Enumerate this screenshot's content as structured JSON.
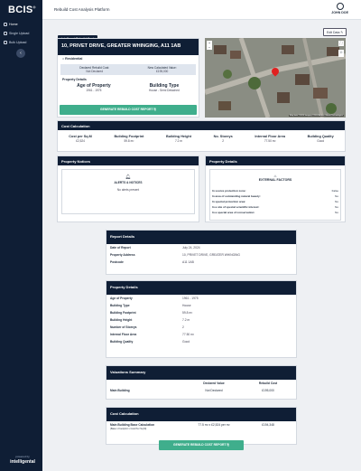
{
  "sidebar": {
    "logo": "BCIS",
    "items": [
      {
        "label": "Home",
        "active": true
      },
      {
        "label": "Single Upload",
        "active": false
      },
      {
        "label": "Bulk Upload",
        "active": false
      }
    ],
    "collapse": "‹",
    "powered_by": "powered by",
    "brand": "intelligental"
  },
  "header": {
    "platform_title": "Rebuild Cost Analysis Platform",
    "user_name": "JOHN DOE"
  },
  "tabs": {
    "active": "Intelligent Rebuild Cost"
  },
  "edit_button": "Edit Data ✎",
  "address": "10, PRIVET DRIVE, GREATER WHINGING, A11 1AB",
  "property_type_tag": "Residential",
  "rebuild": {
    "declared_label": "Declared Rebuild Cost:",
    "declared_value": "Not Declared",
    "calculated_label": "New Calculated Value:",
    "calculated_value": "£195,000"
  },
  "property_details_summary": {
    "title": "Property Details",
    "age_label": "Age of Property",
    "age_value": "1961 - 1975",
    "type_label": "Building Type",
    "type_value": "House - Semi Detached"
  },
  "generate_button": "GENERATE REBUILD COST REPORT",
  "map": {
    "attribution": "Map data ©2024 Imagery ©2024 Airbus, Maxar Technologies"
  },
  "cost_calculation": {
    "title": "Cost Calculation",
    "columns": [
      {
        "label": "Cost per Sq.M",
        "value": "£2,524"
      },
      {
        "label": "Building Footprint",
        "value": "59.8 m²"
      },
      {
        "label": "Building Height",
        "value": "7.2 m"
      },
      {
        "label": "No. Storeys",
        "value": "2"
      },
      {
        "label": "Internal Floor Area",
        "value": "77.50 m²"
      },
      {
        "label": "Building Quality",
        "value": "Good"
      }
    ]
  },
  "notices": {
    "title": "Property Notices",
    "alerts_title": "ALERTS & NOTICES",
    "message": "No alerts present"
  },
  "property_details_panel": {
    "title": "Property Details",
    "ef_title": "EXTERNAL FACTORS",
    "rows": [
      {
        "label": "In source protection zone:",
        "value": "False"
      },
      {
        "label": "In area of outstanding natural beauty:",
        "value": "No"
      },
      {
        "label": "In special protection area:",
        "value": "No"
      },
      {
        "label": "In a site of special scientific interest:",
        "value": "No"
      },
      {
        "label": "In a special area of conservation:",
        "value": "No"
      }
    ]
  },
  "report": {
    "details_title": "Report Details",
    "details": [
      {
        "label": "Date of Report",
        "value": "July 24, 2024"
      },
      {
        "label": "Property Address",
        "value": "10, PRIVET DRIVE, GREATER WHINGING"
      },
      {
        "label": "Postcode",
        "value": "A11 1AB"
      }
    ],
    "property_title": "Property Details",
    "property": [
      {
        "label": "Age of Property",
        "value": "1961 - 1975"
      },
      {
        "label": "Building Type",
        "value": "House"
      },
      {
        "label": "Building Footprint",
        "value": "59.8 m²"
      },
      {
        "label": "Building Height",
        "value": "7.2 m"
      },
      {
        "label": "Number of Storeys",
        "value": "2"
      },
      {
        "label": "Internal Floor Area",
        "value": "77.50 m²"
      },
      {
        "label": "Building Quality",
        "value": "Good"
      }
    ],
    "valuation_title": "Valuations Summary",
    "valuation_head": {
      "declared": "Declared Value",
      "rebuild": "Rebuild Cost"
    },
    "valuation_row": {
      "label": "Main Building",
      "declared": "Not Declared",
      "rebuild": "£195,000"
    },
    "cost_title": "Cost Calculation",
    "cost_row": {
      "label": "Main Building Base Calculation",
      "sublabel": "(Base x Footprint x Cost Per Sq.M)",
      "formula": "77.5 m² x £2,524 per m²",
      "value": "£194,348"
    }
  }
}
